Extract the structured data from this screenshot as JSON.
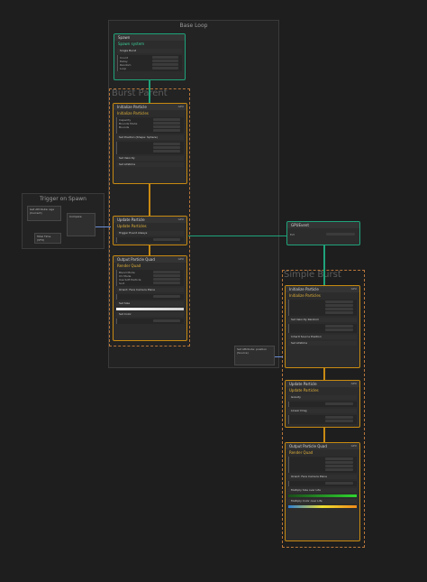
{
  "groups": {
    "base_loop": "Base Loop",
    "trigger_on_spawn": "Trigger on Spawn"
  },
  "labels": {
    "burst_parent": "Burst Parent",
    "simple_burst": "Simple Burst"
  },
  "spawn": {
    "title": "Spawn",
    "context": "Spawn system",
    "block": "Single Burst",
    "rows": [
      "Count",
      "Delay",
      "Random",
      "Loop"
    ]
  },
  "bp_init": {
    "title": "Initialize Particle",
    "context": "Initialize Particles",
    "rows": [
      "Capacity",
      "Bounds Mode"
    ],
    "bounds": "Bounds",
    "block1": "Set Position (Shape: Sphere)",
    "block2": "Set Velocity",
    "block3": "Set Lifetime"
  },
  "bp_update": {
    "title": "Update Particle",
    "context": "Update Particles",
    "block": "Trigger Event Always"
  },
  "bp_output": {
    "title": "Output Particle Quad",
    "context": "Render Quad",
    "rows": [
      "Blend Mode",
      "UV Mode",
      "Use Soft Particle",
      "Sort"
    ],
    "block1": "Orient: Face Camera Plane",
    "block2": "Set Size",
    "block3": "Set Color"
  },
  "gpu_event": {
    "title": "GPUEvent",
    "row": "Evt"
  },
  "sb_init": {
    "title": "Initialize Particle",
    "context": "Initialize Particles",
    "block1": "Set Velocity Random",
    "block2": "Inherit Source Position",
    "block3": "Set Lifetime"
  },
  "sb_update": {
    "title": "Update Particle",
    "context": "Update Particles",
    "block1": "Gravity",
    "block2": "Linear Drag"
  },
  "sb_output": {
    "title": "Output Particle Quad",
    "context": "Render Quad",
    "block1": "Orient: Face Camera Plane",
    "block2": "Multiply Size over Life",
    "block3": "Multiply Color over Life"
  },
  "trigger_nodes": {
    "n1": "Get Attribute: age (Current)",
    "n2": "Compare",
    "n3": "Total Time (VFX)"
  },
  "param_node": {
    "title": "Set Attribute: position (Source)"
  }
}
